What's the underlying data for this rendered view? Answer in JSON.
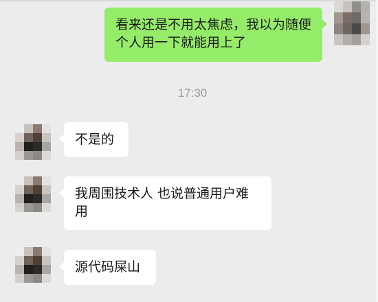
{
  "messages": [
    {
      "sender": "self",
      "text": "看来还是不用太焦虑，我以为随便个人用一下就能用上了"
    },
    {
      "type": "timestamp",
      "text": "17:30"
    },
    {
      "sender": "friend",
      "text": "不是的"
    },
    {
      "sender": "friend",
      "text": "我周围技术人 也说普通用户难用"
    },
    {
      "sender": "friend",
      "text": "源代码屎山"
    }
  ],
  "colors": {
    "background": "#ececec",
    "self_bubble": "#95ec69",
    "friend_bubble": "#ffffff",
    "timestamp_text": "#9b9b9b"
  }
}
